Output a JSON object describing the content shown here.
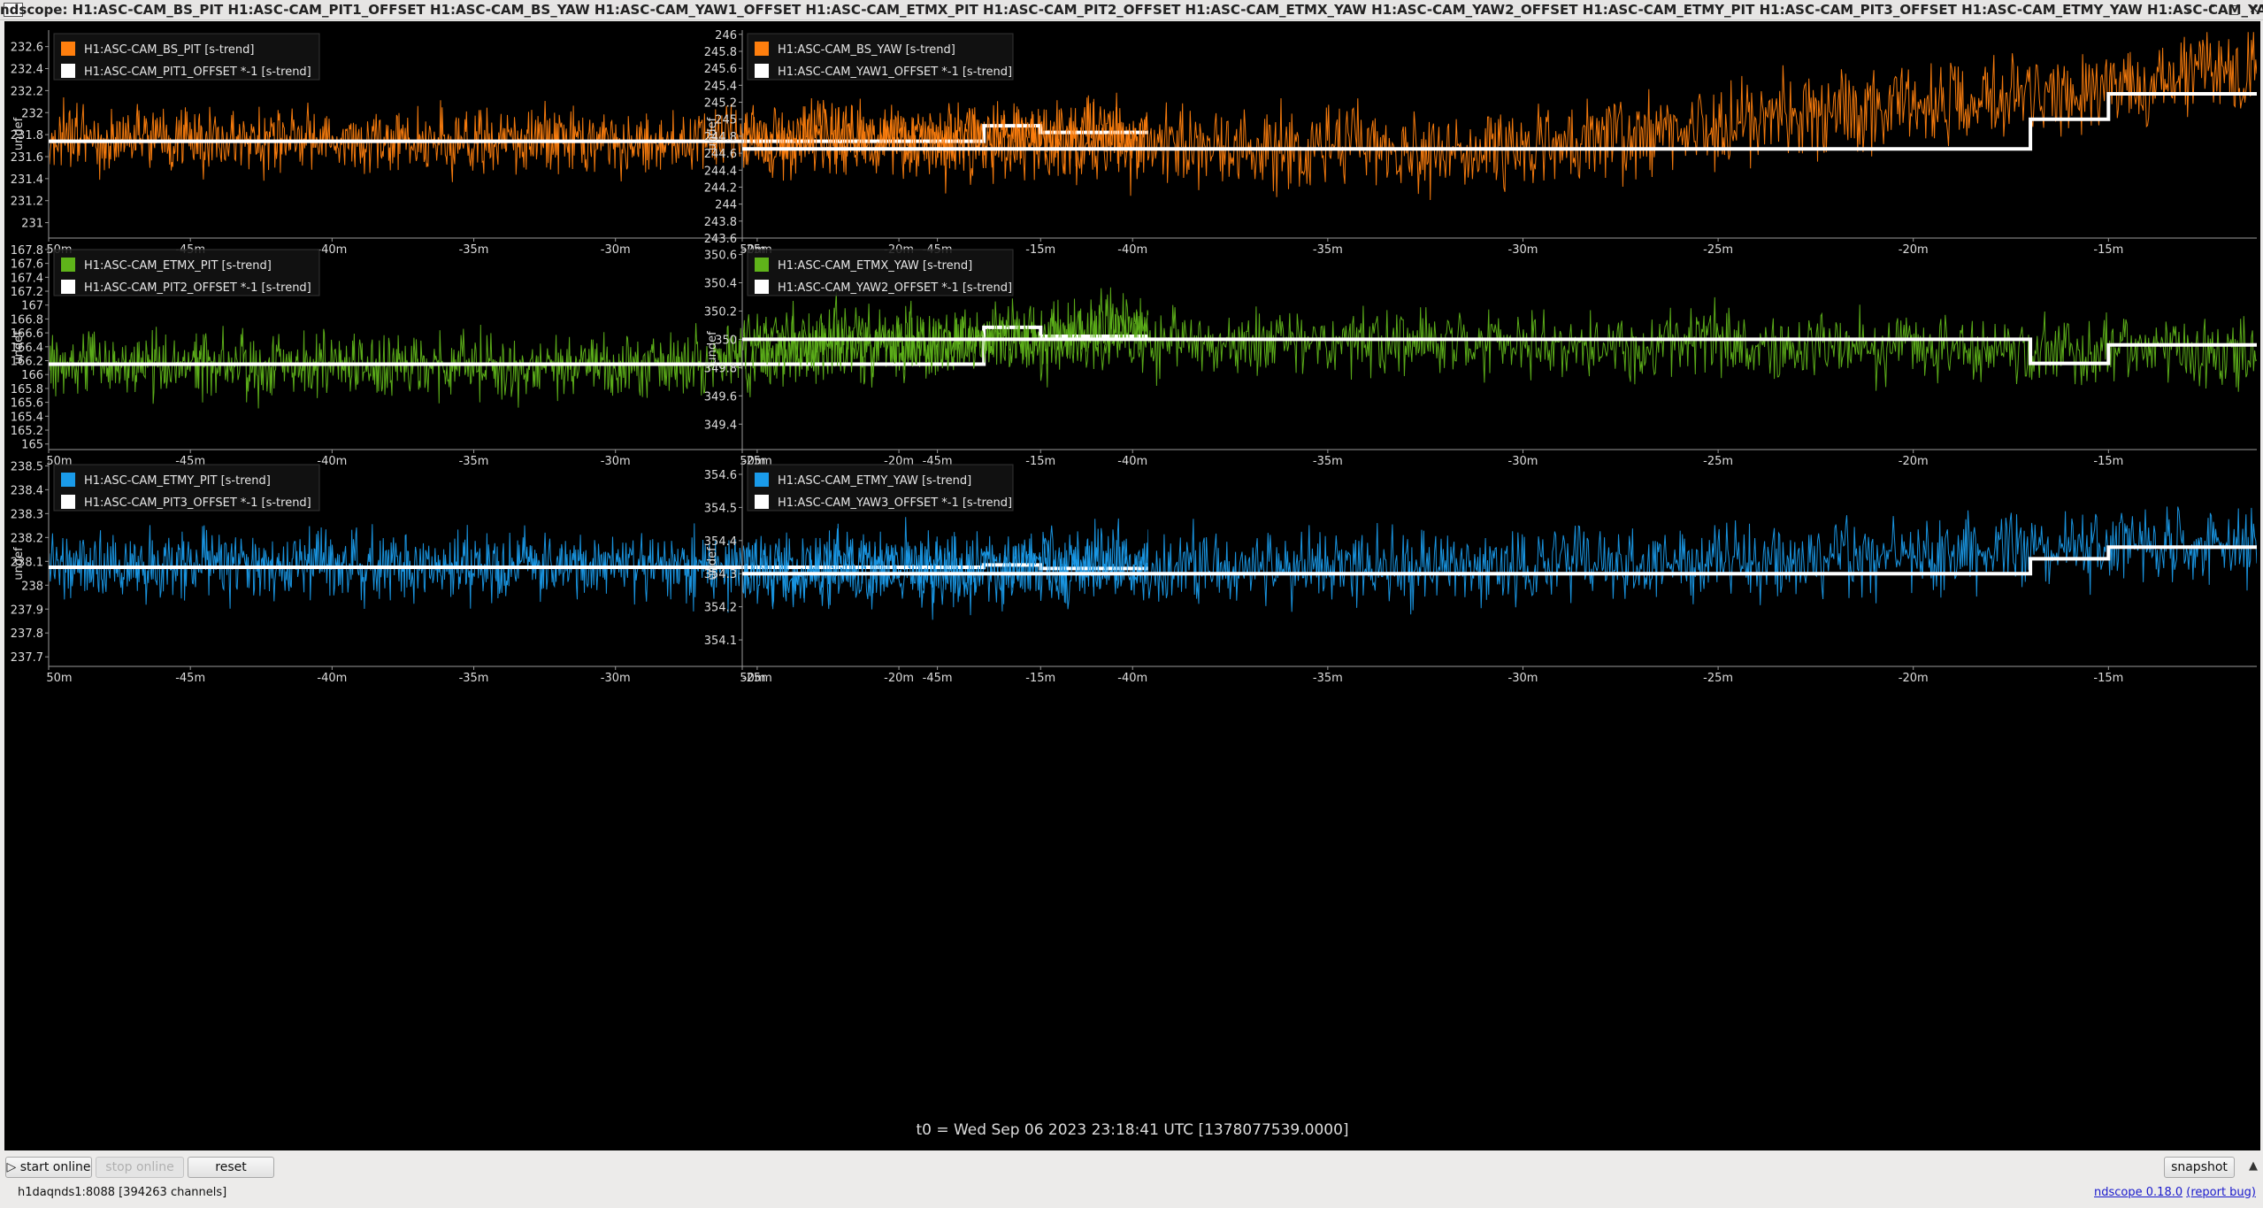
{
  "window": {
    "title": "ndscope: H1:ASC-CAM_BS_PIT H1:ASC-CAM_PIT1_OFFSET H1:ASC-CAM_BS_YAW H1:ASC-CAM_YAW1_OFFSET H1:ASC-CAM_ETMX_PIT H1:ASC-CAM_PIT2_OFFSET H1:ASC-CAM_ETMX_YAW H1:ASC-CAM_YAW2_OFFSET H1:ASC-CAM_ETMY_PIT H1:ASC-CAM_PIT3_OFFSET H1:ASC-CAM_ETMY_YAW H1:ASC-CAM_YAW3"
  },
  "t0_label": "t0 = Wed Sep 06 2023 23:18:41 UTC [1378077539.0000]",
  "buttons": {
    "start_online": "start online",
    "stop_online": "stop online",
    "reset": "reset",
    "snapshot": "snapshot"
  },
  "status": {
    "server": "h1daqnds1:8088  [394263 channels]",
    "version": "ndscope 0.18.0",
    "report_bug": "(report bug)"
  },
  "colors": {
    "orange": "#ff7f0e",
    "green": "#5fb31a",
    "blue": "#1a9bea",
    "white": "#ffffff",
    "background": "#000000"
  },
  "chart_data": [
    {
      "type": "line",
      "ylabel": "undef",
      "x_ticks": [
        "-50m",
        "-45m",
        "-40m",
        "-35m",
        "-30m",
        "-25m",
        "-20m",
        "-15m"
      ],
      "y_ticks": [
        "232.6",
        "232.4",
        "232.2",
        "232",
        "231.8",
        "231.6",
        "231.4",
        "231.2",
        "231"
      ],
      "ylim": [
        230.86,
        232.75
      ],
      "legend_placement": "top-left",
      "series": [
        {
          "name": "H1:ASC-CAM_BS_PIT [s-trend]",
          "color": "#ff7f0e",
          "mean": 231.75,
          "spread": 0.2,
          "drift": [
            0,
            0,
            0.05
          ]
        },
        {
          "name": "H1:ASC-CAM_PIT1_OFFSET *-1 [s-trend]",
          "color": "#ffffff",
          "steps": [
            [
              -50,
              231.74
            ],
            [
              -17,
              231.88
            ],
            [
              -15,
              231.82
            ]
          ]
        }
      ]
    },
    {
      "type": "line",
      "ylabel": "undef",
      "x_ticks": [
        "-50m",
        "-45m",
        "-40m",
        "-35m",
        "-30m",
        "-25m",
        "-20m",
        "-15m"
      ],
      "y_ticks": [
        "246",
        "245.8",
        "245.6",
        "245.4",
        "245.2",
        "245",
        "244.8",
        "244.6",
        "244.4",
        "244.2",
        "244",
        "243.8",
        "243.6"
      ],
      "ylim": [
        243.6,
        246.05
      ],
      "legend_placement": "top-left",
      "series": [
        {
          "name": "H1:ASC-CAM_BS_YAW [s-trend]",
          "color": "#ff7f0e",
          "mean": 244.75,
          "spread": 0.35,
          "drift": [
            0,
            -0.1,
            0.8
          ]
        },
        {
          "name": "H1:ASC-CAM_YAW1_OFFSET *-1 [s-trend]",
          "color": "#ffffff",
          "steps": [
            [
              -50,
              244.65
            ],
            [
              -17,
              245.0
            ],
            [
              -15,
              245.3
            ]
          ]
        }
      ]
    },
    {
      "type": "line",
      "ylabel": "undef",
      "x_ticks": [
        "-50m",
        "-45m",
        "-40m",
        "-35m",
        "-30m",
        "-25m",
        "-20m",
        "-15m"
      ],
      "y_ticks": [
        "167.8",
        "167.6",
        "167.4",
        "167.2",
        "167",
        "166.8",
        "166.6",
        "166.4",
        "166.2",
        "166",
        "165.8",
        "165.6",
        "165.4",
        "165.2",
        "165"
      ],
      "ylim": [
        164.92,
        167.85
      ],
      "legend_placement": "top-left",
      "series": [
        {
          "name": "H1:ASC-CAM_ETMX_PIT [s-trend]",
          "color": "#5fb31a",
          "mean": 166.15,
          "spread": 0.32,
          "drift": [
            0,
            -0.05,
            0.55
          ]
        },
        {
          "name": "H1:ASC-CAM_PIT2_OFFSET *-1 [s-trend]",
          "color": "#ffffff",
          "steps": [
            [
              -50,
              166.15
            ],
            [
              -17,
              166.68
            ],
            [
              -15,
              166.55
            ]
          ]
        }
      ]
    },
    {
      "type": "line",
      "ylabel": "undef",
      "x_ticks": [
        "-50m",
        "-45m",
        "-40m",
        "-35m",
        "-30m",
        "-25m",
        "-20m",
        "-15m"
      ],
      "y_ticks": [
        "350.6",
        "350.4",
        "350.2",
        "350",
        "349.8",
        "349.6",
        "349.4"
      ],
      "ylim": [
        349.22,
        350.66
      ],
      "legend_placement": "top-left",
      "series": [
        {
          "name": "H1:ASC-CAM_ETMX_YAW [s-trend]",
          "color": "#5fb31a",
          "mean": 350.0,
          "spread": 0.17,
          "drift": [
            0,
            -0.03,
            -0.08
          ]
        },
        {
          "name": "H1:ASC-CAM_YAW2_OFFSET *-1 [s-trend]",
          "color": "#ffffff",
          "steps": [
            [
              -50,
              350.0
            ],
            [
              -17,
              349.83
            ],
            [
              -15,
              349.96
            ]
          ]
        }
      ]
    },
    {
      "type": "line",
      "ylabel": "undef",
      "x_ticks": [
        "-50m",
        "-45m",
        "-40m",
        "-35m",
        "-30m",
        "-25m",
        "-20m",
        "-15m"
      ],
      "y_ticks": [
        "238.5",
        "238.4",
        "238.3",
        "238.2",
        "238.1",
        "238",
        "237.9",
        "237.8",
        "237.7"
      ],
      "ylim": [
        237.66,
        238.52
      ],
      "legend_placement": "top-left",
      "series": [
        {
          "name": "H1:ASC-CAM_ETMY_PIT [s-trend]",
          "color": "#1a9bea",
          "mean": 238.08,
          "spread": 0.1,
          "drift": [
            0,
            0,
            0
          ]
        },
        {
          "name": "H1:ASC-CAM_PIT3_OFFSET *-1 [s-trend]",
          "color": "#ffffff",
          "steps": [
            [
              -50,
              238.075
            ],
            [
              -17,
              238.085
            ],
            [
              -15,
              238.07
            ]
          ]
        }
      ]
    },
    {
      "type": "line",
      "ylabel": "undef",
      "x_ticks": [
        "-50m",
        "-45m",
        "-40m",
        "-35m",
        "-30m",
        "-25m",
        "-20m",
        "-15m"
      ],
      "y_ticks": [
        "354.6",
        "354.5",
        "354.4",
        "354.3",
        "354.2",
        "354.1"
      ],
      "ylim": [
        354.02,
        354.64
      ],
      "legend_placement": "top-left",
      "series": [
        {
          "name": "H1:ASC-CAM_ETMY_YAW [s-trend]",
          "color": "#1a9bea",
          "mean": 354.31,
          "spread": 0.08,
          "drift": [
            0,
            0.01,
            0.08
          ]
        },
        {
          "name": "H1:ASC-CAM_YAW3_OFFSET *-1 [s-trend]",
          "color": "#ffffff",
          "steps": [
            [
              -50,
              354.3
            ],
            [
              -17,
              354.345
            ],
            [
              -15,
              354.38
            ]
          ]
        }
      ]
    }
  ]
}
